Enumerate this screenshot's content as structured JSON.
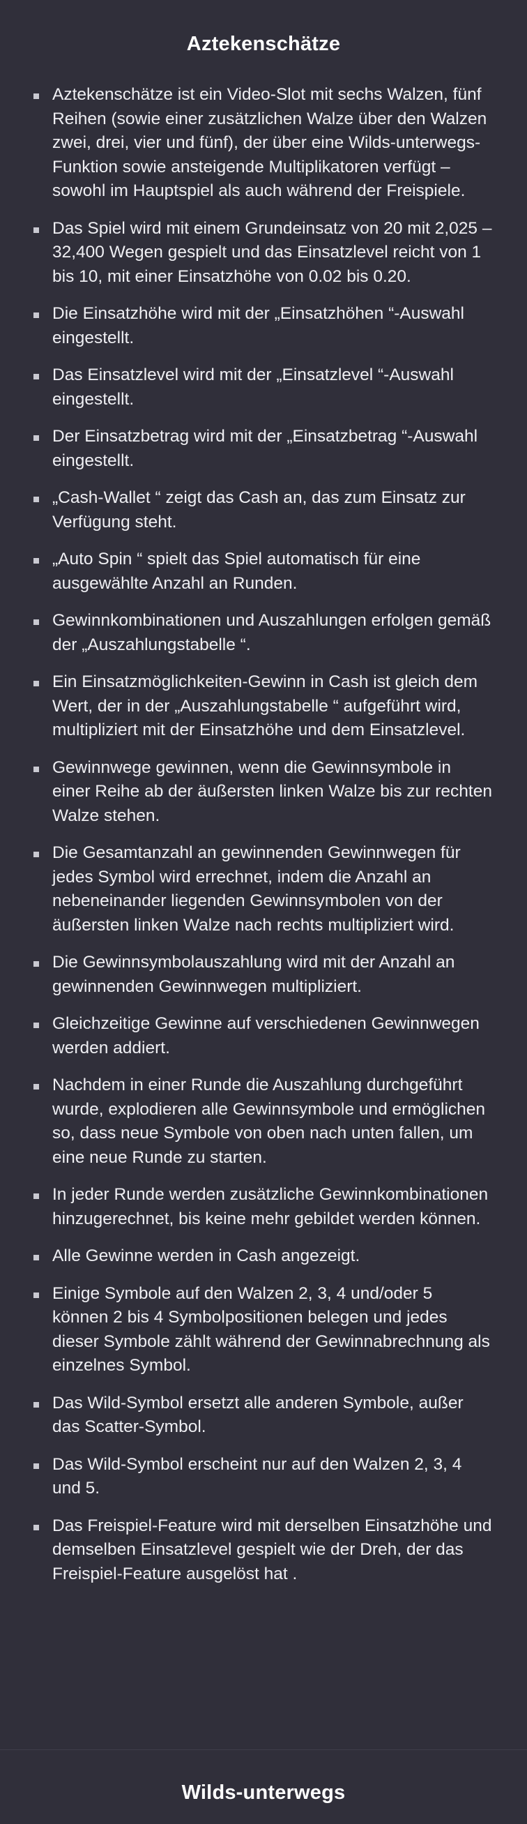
{
  "sections": {
    "top_title": "Aztekenschätze",
    "bottom_title": "Wilds-unterwegs"
  },
  "rules": [
    "Aztekenschätze ist ein Video-Slot mit sechs Walzen, fünf Reihen (sowie einer zusätzlichen Walze über den Walzen zwei, drei, vier und fünf), der über eine Wilds-unterwegs-Funktion sowie ansteigende Multiplikatoren verfügt – sowohl im Hauptspiel als auch während der Freispiele.",
    "Das Spiel wird mit einem Grundeinsatz von 20 mit 2,025 – 32,400 Wegen gespielt und das Einsatzlevel reicht von 1 bis 10, mit einer Einsatzhöhe von 0.02 bis 0.20.",
    "Die Einsatzhöhe wird mit der „Einsatzhöhen  “-Auswahl eingestellt.",
    "Das Einsatzlevel wird mit der „Einsatzlevel  “-Auswahl eingestellt.",
    "Der Einsatzbetrag wird mit der „Einsatzbetrag  “-Auswahl eingestellt.",
    "„Cash-Wallet  “ zeigt das Cash an, das zum Einsatz zur Verfügung steht.",
    "„Auto Spin  “ spielt das Spiel automatisch für eine ausgewählte Anzahl an Runden.",
    "Gewinnkombinationen und Auszahlungen erfolgen gemäß der „Auszahlungstabelle  “.",
    "Ein Einsatzmöglichkeiten-Gewinn in Cash ist gleich dem Wert, der in der „Auszahlungstabelle  “ aufgeführt wird, multipliziert mit der Einsatzhöhe und dem Einsatzlevel.",
    "Gewinnwege gewinnen, wenn die Gewinnsymbole in einer Reihe ab der äußersten linken Walze bis zur rechten Walze stehen.",
    "Die Gesamtanzahl an gewinnenden Gewinnwegen für jedes Symbol wird errechnet, indem die Anzahl an nebeneinander liegenden Gewinnsymbolen von der äußersten linken Walze nach rechts multipliziert wird.",
    "Die Gewinnsymbolauszahlung wird mit der Anzahl an gewinnenden Gewinnwegen multipliziert.",
    "Gleichzeitige Gewinne auf verschiedenen Gewinnwegen werden addiert.",
    "Nachdem in einer Runde die Auszahlung durchgeführt wurde, explodieren alle Gewinnsymbole und ermöglichen so, dass neue Symbole von oben nach unten fallen, um eine neue Runde zu starten.",
    "In jeder Runde werden zusätzliche Gewinnkombinationen hinzugerechnet, bis keine mehr gebildet werden können.",
    "Alle Gewinne werden in Cash angezeigt.",
    "Einige Symbole auf den Walzen 2, 3, 4 und/oder 5 können 2 bis 4 Symbolpositionen belegen und jedes dieser Symbole zählt während der Gewinnabrechnung als einzelnes Symbol.",
    "Das Wild-Symbol ersetzt alle anderen Symbole, außer das Scatter-Symbol.",
    "Das Wild-Symbol erscheint nur auf den Walzen 2, 3, 4 und 5.",
    "Das Freispiel-Feature wird mit derselben Einsatzhöhe und demselben Einsatzlevel gespielt wie der Dreh, der das Freispiel-Feature ausgelöst hat ."
  ]
}
